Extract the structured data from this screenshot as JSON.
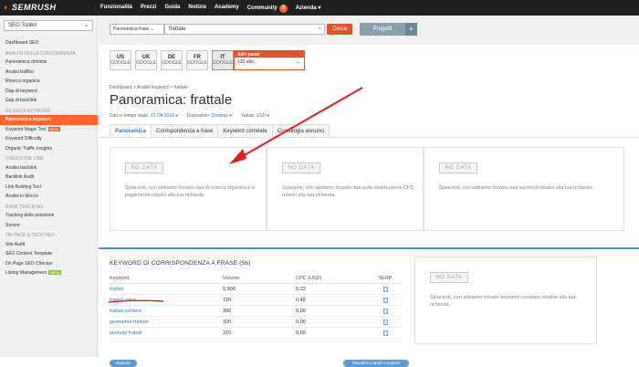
{
  "topbar": {
    "logo": "SEMRUSH",
    "nav": [
      "Funzionalità",
      "Prezzi",
      "Guida",
      "Notizie",
      "Academy",
      "Community",
      "Azienda"
    ],
    "community_badge": "3",
    "azienda_chevron": "▾"
  },
  "sidebar": {
    "toolkit": "SEO Toolkit",
    "toolkit_chevron": "⌄",
    "items": [
      {
        "label": "Dashboard SEO",
        "type": "item"
      },
      {
        "label": "ANALISI DELLA CONCORRENZA",
        "type": "section"
      },
      {
        "label": "Panoramica dominio",
        "type": "item"
      },
      {
        "label": "Analisi traffico",
        "type": "item"
      },
      {
        "label": "Ricerca organica",
        "type": "item"
      },
      {
        "label": "Gap di keyword",
        "type": "item"
      },
      {
        "label": "Gap di backlink",
        "type": "item"
      },
      {
        "label": "RICERCA KEYWORD",
        "type": "section"
      },
      {
        "label": "Panoramica keyword",
        "type": "active"
      },
      {
        "label": "Keyword Magic Tool",
        "type": "item",
        "tag": "NEW"
      },
      {
        "label": "Keyword Difficulty",
        "type": "item"
      },
      {
        "label": "Organic Traffic Insights",
        "type": "item"
      },
      {
        "label": "CREAZIONE LINK",
        "type": "section"
      },
      {
        "label": "Analisi backlink",
        "type": "item"
      },
      {
        "label": "Backlink Audit",
        "type": "item"
      },
      {
        "label": "Link Building Tool",
        "type": "item"
      },
      {
        "label": "Analisi in blocco",
        "type": "item"
      },
      {
        "label": "RANK TRACKING",
        "type": "section"
      },
      {
        "label": "Tracking della posizione",
        "type": "item"
      },
      {
        "label": "Sensor",
        "type": "item"
      },
      {
        "label": "ON PAGE & TECH SEO",
        "type": "section"
      },
      {
        "label": "Site Audit",
        "type": "item"
      },
      {
        "label": "SEO Content Template",
        "type": "item"
      },
      {
        "label": "On Page SEO Checker",
        "type": "item"
      },
      {
        "label": "Listing Management",
        "type": "item",
        "tag": "BETA"
      }
    ]
  },
  "search": {
    "database": "Panoramica frase",
    "database_chevron": "⌄",
    "query": "frattale",
    "clear": "×",
    "submit": "Cerca",
    "projects": "Progetti",
    "add": "+"
  },
  "databases": [
    {
      "code": "US",
      "sub": "GOOGLE",
      "selected": false
    },
    {
      "code": "UK",
      "sub": "GOOGLE",
      "selected": false
    },
    {
      "code": "DE",
      "sub": "GOOGLE",
      "selected": false
    },
    {
      "code": "FR",
      "sub": "GOOGLE",
      "selected": false
    },
    {
      "code": "IT",
      "sub": "GOOGLE",
      "selected": true
    }
  ],
  "altri_paesi": {
    "title": "Altri paesi",
    "value": "130 altri...",
    "chevron": "⌄"
  },
  "breadcrumb": "Dashboard  >  Analisi keyword  >  frattale",
  "page_title": "Panoramica: frattale",
  "meta": {
    "realtime_label": "Dati in tempo reale:",
    "realtime_value": "23 Ott 2018 ▾",
    "device_label": "Dispositivo:",
    "device_value": "Desktop ▾",
    "currency_label": "Valuta:",
    "currency_value": "USD ▾"
  },
  "tabs": [
    "Panoramica",
    "Corrispondenza a frase",
    "Keyword correlate",
    "Cronologia annunci"
  ],
  "cards": [
    {
      "badge": "NO DATA",
      "text": "Spiacenti, non abbiamo trovato dati di ricerca organica e a pagamento relativi alla tua richiesta."
    },
    {
      "badge": "NO DATA",
      "text": "Spiacenti, non abbiamo trovato dati sulla distribuzione CPC relativi alla tua richiesta."
    },
    {
      "badge": "NO DATA",
      "text": "Spiacenti, non abbiamo trovato dati sul trend relativi alla tua richiesta."
    }
  ],
  "phrase_table": {
    "title": "KEYWORD DI CORRISPONDENZA A FRASE (56)",
    "headers": [
      "Keyword",
      "Volume",
      "CPC (USD)",
      "SERP"
    ],
    "rows": [
      [
        "frattali",
        "9,900",
        "0.22"
      ],
      [
        "frattali roma",
        "720",
        "0.49"
      ],
      [
        "frattali portiere",
        "390",
        "0.00"
      ],
      [
        "geometria frattale",
        "320",
        "0.00"
      ],
      [
        "pierluigi frattali",
        "320",
        "0.00"
      ]
    ],
    "export": "Esporta",
    "full_report": "Visualizza report completo"
  },
  "related_card": {
    "badge": "NO DATA",
    "text": "Spiacenti, non abbiamo trovato keyword correlate relative alla tua richiesta."
  },
  "colors": {
    "brand": "#ff642d",
    "cta": "#e2542c",
    "link": "#3a7abf",
    "topbar": "#1f1f1f",
    "annotation": "#e02020"
  }
}
